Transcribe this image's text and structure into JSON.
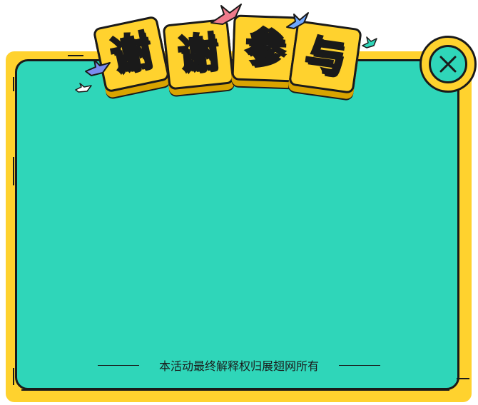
{
  "dialog": {
    "title_chars": [
      "谢",
      "谢",
      "参",
      "与"
    ],
    "footer_text": "本活动最终解释权归展翅网所有",
    "close_icon": "close-icon",
    "colors": {
      "frame": "#ffd22e",
      "panel": "#2fd6b9",
      "outline": "#1a1a1a",
      "title_text": "#ffffff"
    }
  }
}
